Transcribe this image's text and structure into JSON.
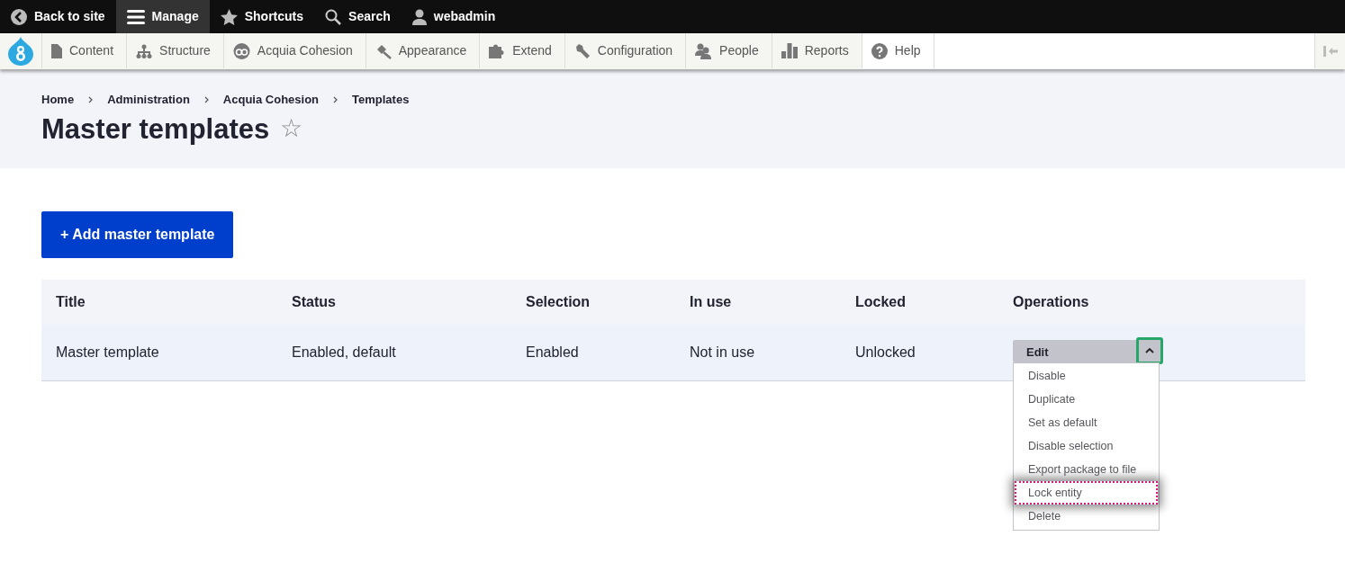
{
  "toolbar": {
    "items": [
      {
        "label": "Back to site",
        "selected": false
      },
      {
        "label": "Manage",
        "selected": true
      },
      {
        "label": "Shortcuts",
        "selected": false
      },
      {
        "label": "Search",
        "selected": false
      },
      {
        "label": "webadmin",
        "selected": false
      }
    ]
  },
  "admin_menu": {
    "items": [
      {
        "label": "Content",
        "selected": false
      },
      {
        "label": "Structure",
        "selected": false
      },
      {
        "label": "Acquia Cohesion",
        "selected": false
      },
      {
        "label": "Appearance",
        "selected": false
      },
      {
        "label": "Extend",
        "selected": false
      },
      {
        "label": "Configuration",
        "selected": false
      },
      {
        "label": "People",
        "selected": false
      },
      {
        "label": "Reports",
        "selected": false
      },
      {
        "label": "Help",
        "selected": true
      }
    ]
  },
  "breadcrumb": [
    "Home",
    "Administration",
    "Acquia Cohesion",
    "Templates"
  ],
  "page_title": "Master templates",
  "shortcut_star": "☆",
  "add_button": "+ Add master template",
  "table": {
    "columns": [
      "Title",
      "Status",
      "Selection",
      "In use",
      "Locked",
      "Operations"
    ],
    "rows": [
      {
        "cells": [
          "Master template",
          "Enabled, default",
          "Enabled",
          "Not in use",
          "Unlocked"
        ],
        "operations": {
          "primary": "Edit",
          "expanded": true,
          "items": [
            {
              "label": "Disable",
              "focused": false
            },
            {
              "label": "Duplicate",
              "focused": false
            },
            {
              "label": "Set as default",
              "focused": false
            },
            {
              "label": "Disable selection",
              "focused": false
            },
            {
              "label": "Export package to file",
              "focused": false
            },
            {
              "label": "Lock entity",
              "focused": true
            },
            {
              "label": "Delete",
              "focused": false
            }
          ]
        }
      }
    ]
  }
}
